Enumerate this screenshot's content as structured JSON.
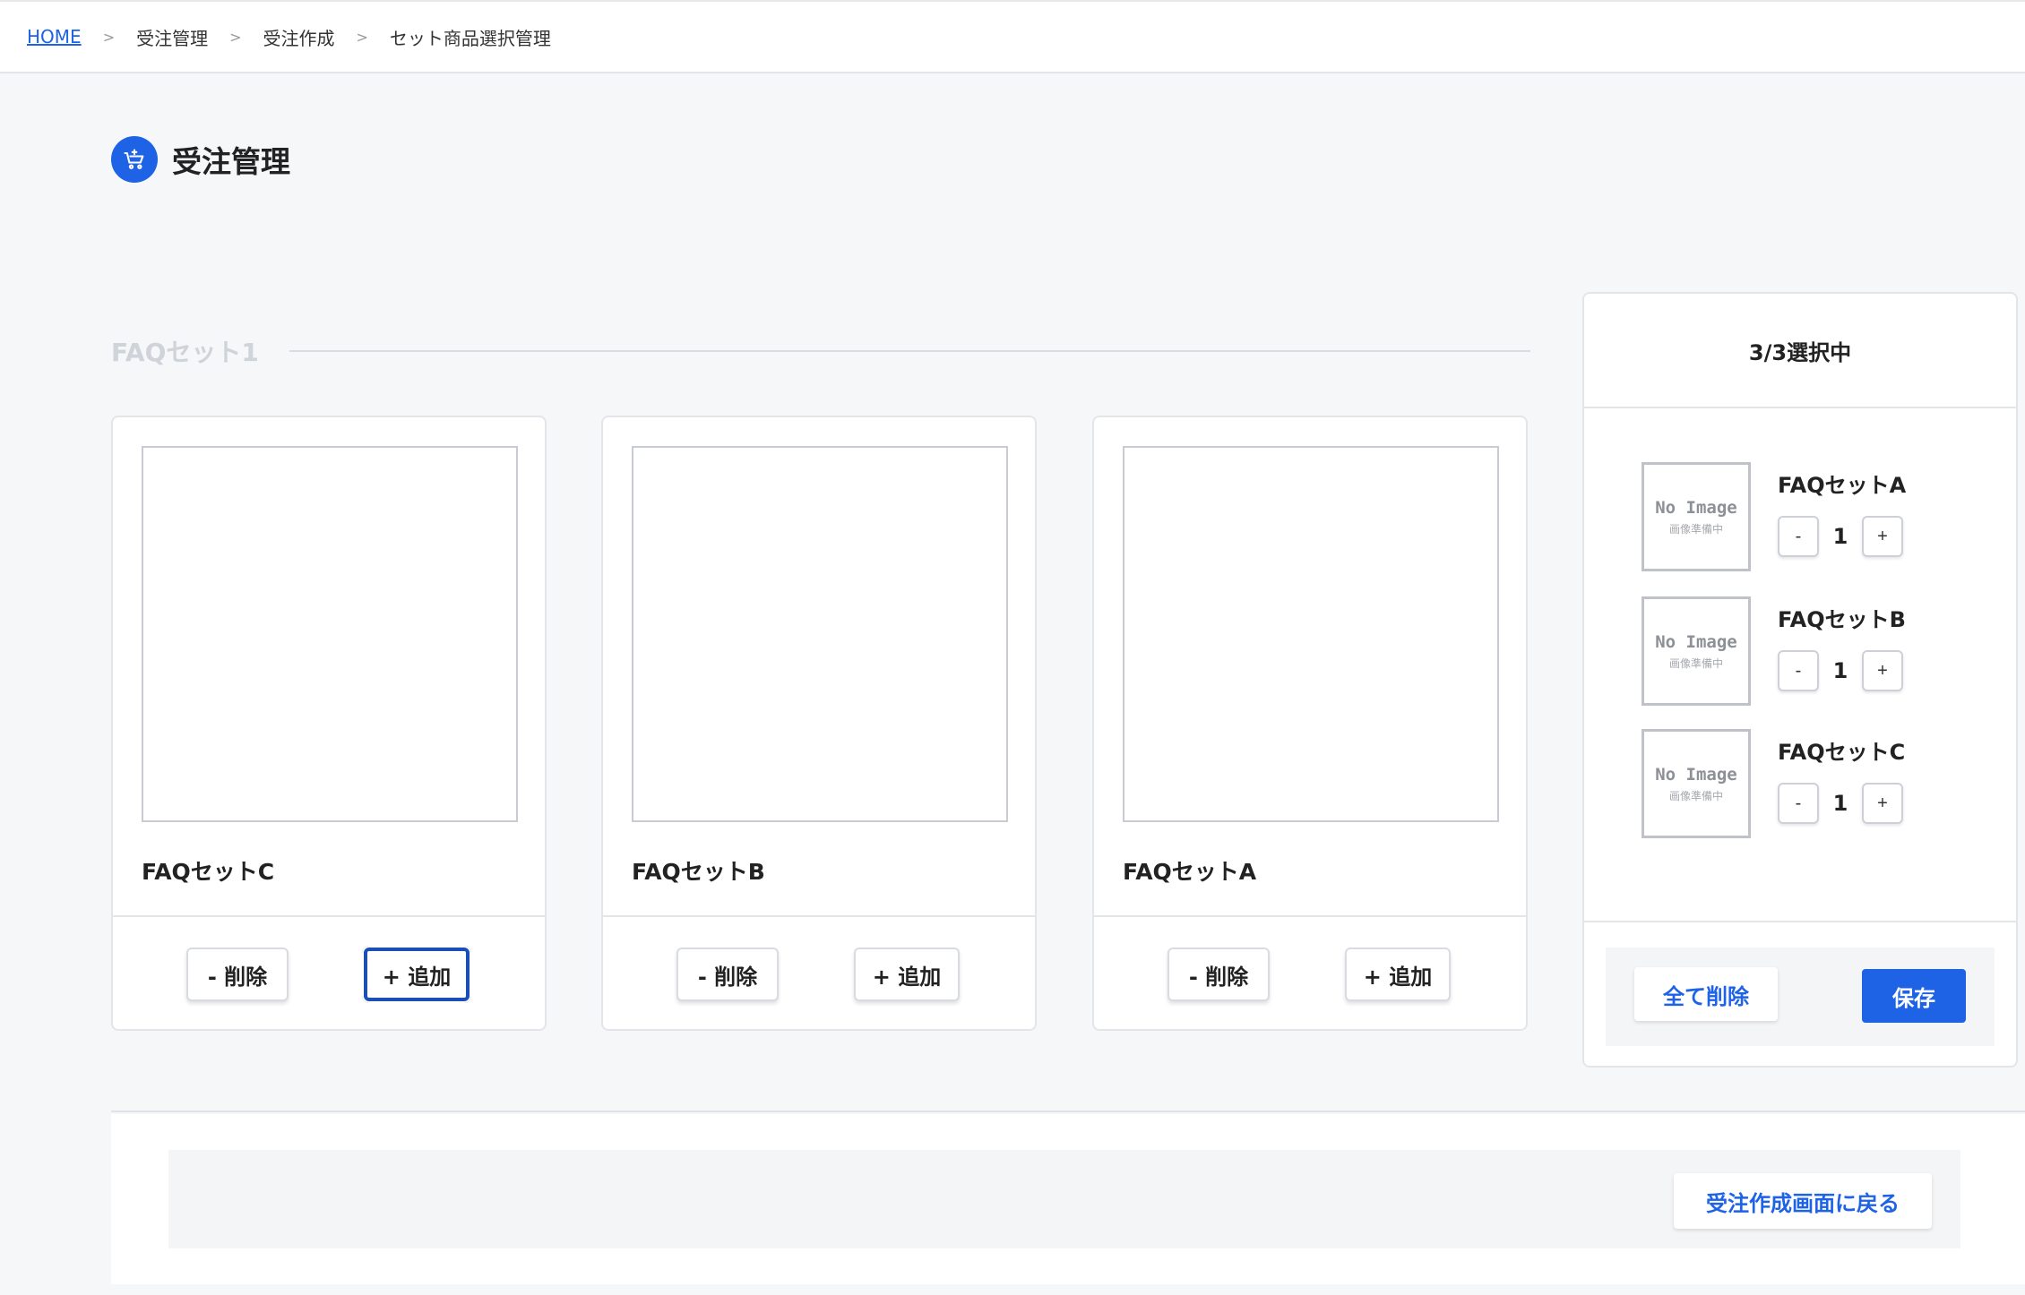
{
  "breadcrumb": {
    "items": [
      "HOME",
      "受注管理",
      "受注作成",
      "セット商品選択管理"
    ],
    "separator": ">"
  },
  "page": {
    "title": "受注管理",
    "icon": "cart-icon",
    "accent_color": "#1e62e6"
  },
  "section": {
    "title": "FAQセット1"
  },
  "cards": [
    {
      "name": "FAQセットC",
      "delete_label": "- 削除",
      "add_label": "+ 追加"
    },
    {
      "name": "FAQセットB",
      "delete_label": "- 削除",
      "add_label": "+ 追加"
    },
    {
      "name": "FAQセットA",
      "delete_label": "- 削除",
      "add_label": "+ 追加"
    }
  ],
  "selection": {
    "header": "3/3選択中",
    "no_image_main": "No Image",
    "no_image_sub": "画像準備中",
    "minus_label": "-",
    "plus_label": "+",
    "items": [
      {
        "name": "FAQセットA",
        "qty": "1"
      },
      {
        "name": "FAQセットB",
        "qty": "1"
      },
      {
        "name": "FAQセットC",
        "qty": "1"
      }
    ],
    "clear_label": "全て削除",
    "save_label": "保存"
  },
  "footer": {
    "back_label": "受注作成画面に戻る"
  }
}
